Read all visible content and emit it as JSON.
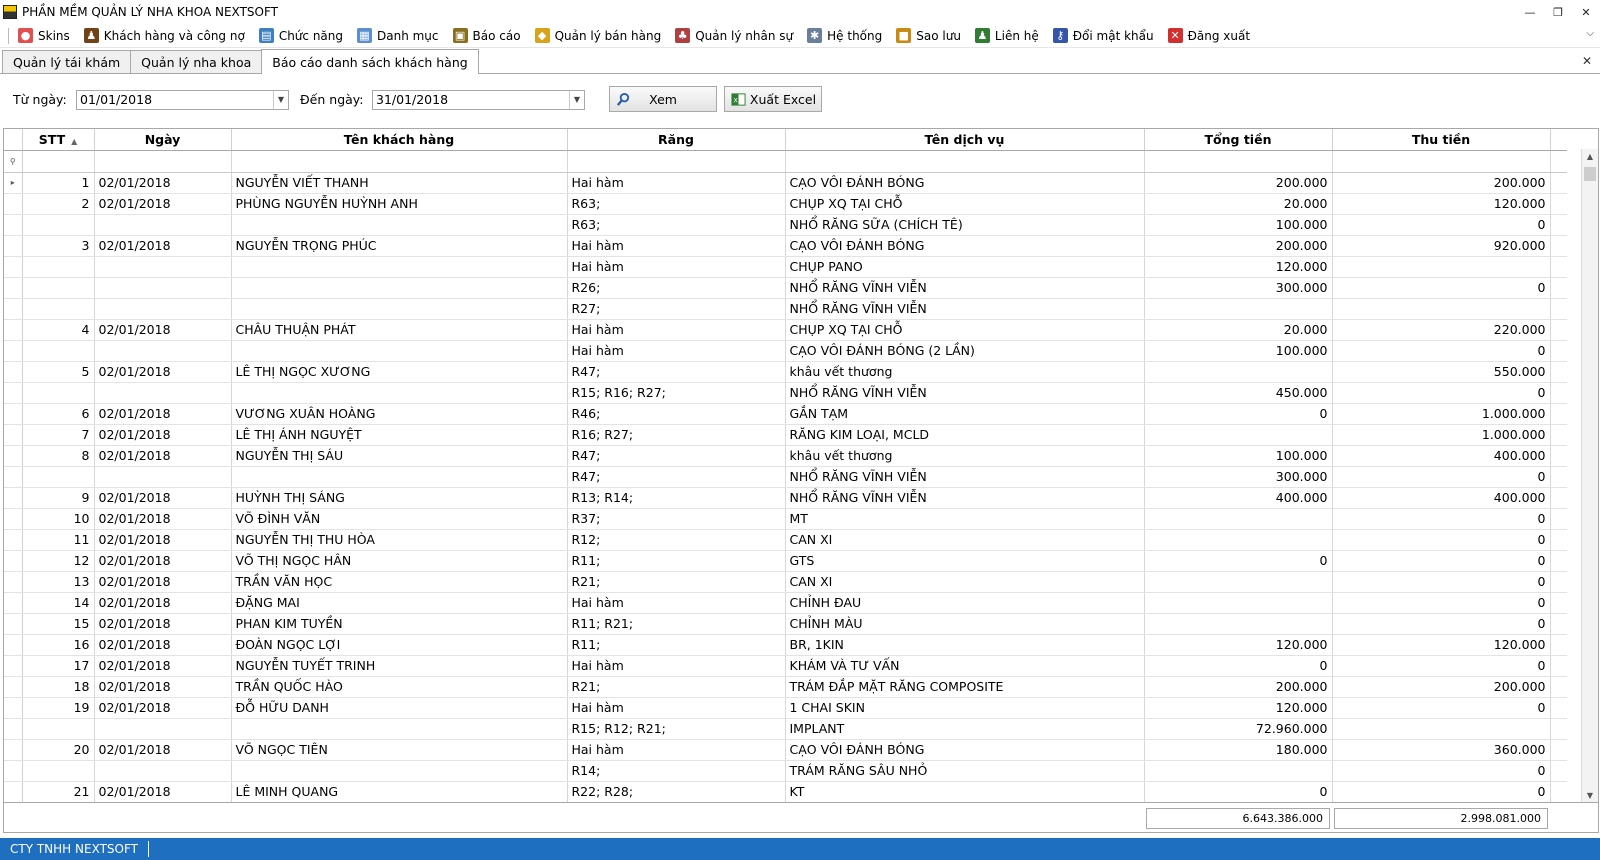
{
  "window": {
    "title": "PHẦN MỀM QUẢN LÝ NHA KHOA NEXTSOFT"
  },
  "menu": [
    {
      "label": "Skins",
      "icon": "palette-icon",
      "color": "#e05050"
    },
    {
      "label": "Khách hàng và công nợ",
      "icon": "person-icon",
      "color": "#704214"
    },
    {
      "label": "Chức năng",
      "icon": "function-icon",
      "color": "#3f7fbf"
    },
    {
      "label": "Danh mục",
      "icon": "category-icon",
      "color": "#5a8fd0"
    },
    {
      "label": "Báo cáo",
      "icon": "report-icon",
      "color": "#8a6d1e"
    },
    {
      "label": "Quản lý bán hàng",
      "icon": "sales-icon",
      "color": "#d9a21b"
    },
    {
      "label": "Quản lý nhân sự",
      "icon": "people-icon",
      "color": "#b04040"
    },
    {
      "label": "Hệ thống",
      "icon": "gear-icon",
      "color": "#6a7f9a"
    },
    {
      "label": "Sao lưu",
      "icon": "backup-icon",
      "color": "#c98a12"
    },
    {
      "label": "Liên hệ",
      "icon": "contact-icon",
      "color": "#2e7d32"
    },
    {
      "label": "Đổi mật khẩu",
      "icon": "key-icon",
      "color": "#3556a8"
    },
    {
      "label": "Đăng xuất",
      "icon": "logout-icon",
      "color": "#d32f2f"
    }
  ],
  "tabs": [
    {
      "label": "Quản lý tái khám",
      "active": false
    },
    {
      "label": "Quản lý nha khoa",
      "active": false
    },
    {
      "label": "Báo cáo danh sách khách hàng",
      "active": true
    }
  ],
  "filter": {
    "from_label": "Từ ngày:",
    "from_value": "01/01/2018",
    "to_label": "Đến ngày:",
    "to_value": "31/01/2018",
    "view_button": "Xem",
    "export_button": "Xuất Excel"
  },
  "grid": {
    "columns": [
      "STT",
      "Ngày",
      "Tên khách hàng",
      "Răng",
      "Tên dịch vụ",
      "Tổng tiền",
      "Thu tiền"
    ],
    "rows": [
      {
        "stt": "1",
        "date": "02/01/2018",
        "name": "NGUYỄN VIẾT THANH",
        "tooth": "Hai hàm",
        "service": "CẠO VÔI ĐÁNH BÓNG",
        "total": "200.000",
        "paid": "200.000"
      },
      {
        "stt": "2",
        "date": "02/01/2018",
        "name": "PHÙNG NGUYỄN HUỲNH ANH",
        "tooth": "R63;",
        "service": "CHỤP XQ TẠI CHỖ",
        "total": "20.000",
        "paid": "120.000"
      },
      {
        "stt": "",
        "date": "",
        "name": "",
        "tooth": "R63;",
        "service": "NHỔ RĂNG SỮA (CHÍCH TÊ)",
        "total": "100.000",
        "paid": "0"
      },
      {
        "stt": "3",
        "date": "02/01/2018",
        "name": "NGUYỄN TRỌNG PHÚC",
        "tooth": "Hai hàm",
        "service": "CẠO VÔI ĐÁNH BÓNG",
        "total": "200.000",
        "paid": "920.000"
      },
      {
        "stt": "",
        "date": "",
        "name": "",
        "tooth": "Hai hàm",
        "service": "CHỤP PANO",
        "total": "120.000",
        "paid": ""
      },
      {
        "stt": "",
        "date": "",
        "name": "",
        "tooth": "R26;",
        "service": "NHỔ RĂNG VĨNH VIỄN",
        "total": "300.000",
        "paid": "0"
      },
      {
        "stt": "",
        "date": "",
        "name": "",
        "tooth": "R27;",
        "service": "NHỔ RĂNG VĨNH VIỄN",
        "total": "",
        "paid": ""
      },
      {
        "stt": "4",
        "date": "02/01/2018",
        "name": "CHÂU THUẬN PHÁT",
        "tooth": "Hai hàm",
        "service": "CHỤP XQ TẠI CHỖ",
        "total": "20.000",
        "paid": "220.000"
      },
      {
        "stt": "",
        "date": "",
        "name": "",
        "tooth": "Hai hàm",
        "service": "CẠO VÔI ĐÁNH BÓNG (2 LẦN)",
        "total": "100.000",
        "paid": "0"
      },
      {
        "stt": "5",
        "date": "02/01/2018",
        "name": "LÊ THỊ NGỌC XƯƠNG",
        "tooth": "R47;",
        "service": "khâu vết thương",
        "total": "",
        "paid": "550.000"
      },
      {
        "stt": "",
        "date": "",
        "name": "",
        "tooth": "R15; R16; R27;",
        "service": "NHỔ RĂNG VĨNH VIỄN",
        "total": "450.000",
        "paid": "0"
      },
      {
        "stt": "6",
        "date": "02/01/2018",
        "name": "VƯƠNG XUÂN HOÀNG",
        "tooth": "R46;",
        "service": "GẮN TẠM",
        "total": "0",
        "paid": "1.000.000"
      },
      {
        "stt": "7",
        "date": "02/01/2018",
        "name": "LÊ THỊ ÁNH NGUYỆT",
        "tooth": "R16; R27;",
        "service": "RĂNG KIM LOẠI, MCLD",
        "total": "",
        "paid": "1.000.000"
      },
      {
        "stt": "8",
        "date": "02/01/2018",
        "name": "NGUYỄN THỊ SÁU",
        "tooth": "R47;",
        "service": "khâu vết thương",
        "total": "100.000",
        "paid": "400.000"
      },
      {
        "stt": "",
        "date": "",
        "name": "",
        "tooth": "R47;",
        "service": "NHỔ RĂNG VĨNH VIỄN",
        "total": "300.000",
        "paid": "0"
      },
      {
        "stt": "9",
        "date": "02/01/2018",
        "name": "HUỲNH THỊ SÁNG",
        "tooth": "R13; R14;",
        "service": "NHỔ RĂNG VĨNH VIỄN",
        "total": "400.000",
        "paid": "400.000"
      },
      {
        "stt": "10",
        "date": "02/01/2018",
        "name": "VÕ ĐÌNH VĂN",
        "tooth": "R37;",
        "service": "MT",
        "total": "",
        "paid": "0"
      },
      {
        "stt": "11",
        "date": "02/01/2018",
        "name": "NGUYỄN THỊ THU HÒA",
        "tooth": "R12;",
        "service": "CAN XI",
        "total": "",
        "paid": "0"
      },
      {
        "stt": "12",
        "date": "02/01/2018",
        "name": "VÕ THỊ NGỌC HÂN",
        "tooth": "R11;",
        "service": "GTS",
        "total": "0",
        "paid": "0"
      },
      {
        "stt": "13",
        "date": "02/01/2018",
        "name": "TRẦN VĂN HỌC",
        "tooth": "R21;",
        "service": "CAN XI",
        "total": "",
        "paid": "0"
      },
      {
        "stt": "14",
        "date": "02/01/2018",
        "name": "ĐẶNG MAI",
        "tooth": "Hai hàm",
        "service": "CHỈNH ĐAU",
        "total": "",
        "paid": "0"
      },
      {
        "stt": "15",
        "date": "02/01/2018",
        "name": "PHAN KIM TUYỀN",
        "tooth": "R11; R21;",
        "service": "CHỈNH MÀU",
        "total": "",
        "paid": "0"
      },
      {
        "stt": "16",
        "date": "02/01/2018",
        "name": "ĐOÀN NGỌC LỢI",
        "tooth": "R11;",
        "service": "BR, 1KIN",
        "total": "120.000",
        "paid": "120.000"
      },
      {
        "stt": "17",
        "date": "02/01/2018",
        "name": "NGUYỄN TUYẾT TRINH",
        "tooth": "Hai hàm",
        "service": "KHÁM VÀ TƯ VẤN",
        "total": "0",
        "paid": "0"
      },
      {
        "stt": "18",
        "date": "02/01/2018",
        "name": "TRẦN QUỐC HÀO",
        "tooth": "R21;",
        "service": "TRÁM ĐẮP MẶT RĂNG COMPOSITE",
        "total": "200.000",
        "paid": "200.000"
      },
      {
        "stt": "19",
        "date": "02/01/2018",
        "name": "ĐỖ HỮU DANH",
        "tooth": "Hai hàm",
        "service": "1 CHAI SKIN",
        "total": "120.000",
        "paid": "0"
      },
      {
        "stt": "",
        "date": "",
        "name": "",
        "tooth": "R15; R12; R21;",
        "service": "IMPLANT",
        "total": "72.960.000",
        "paid": ""
      },
      {
        "stt": "20",
        "date": "02/01/2018",
        "name": "VÕ NGỌC TIÊN",
        "tooth": "Hai hàm",
        "service": "CẠO VÔI ĐÁNH BÓNG",
        "total": "180.000",
        "paid": "360.000"
      },
      {
        "stt": "",
        "date": "",
        "name": "",
        "tooth": "R14;",
        "service": "TRÁM RĂNG SÂU NHỎ",
        "total": "",
        "paid": "0"
      },
      {
        "stt": "21",
        "date": "02/01/2018",
        "name": "LÊ MINH QUANG",
        "tooth": "R22; R28;",
        "service": "KT",
        "total": "0",
        "paid": "0"
      }
    ]
  },
  "totals": {
    "total": "6.643.386.000",
    "paid": "2.998.081.000"
  },
  "status": {
    "company": "CTY TNHH NEXTSOFT"
  }
}
